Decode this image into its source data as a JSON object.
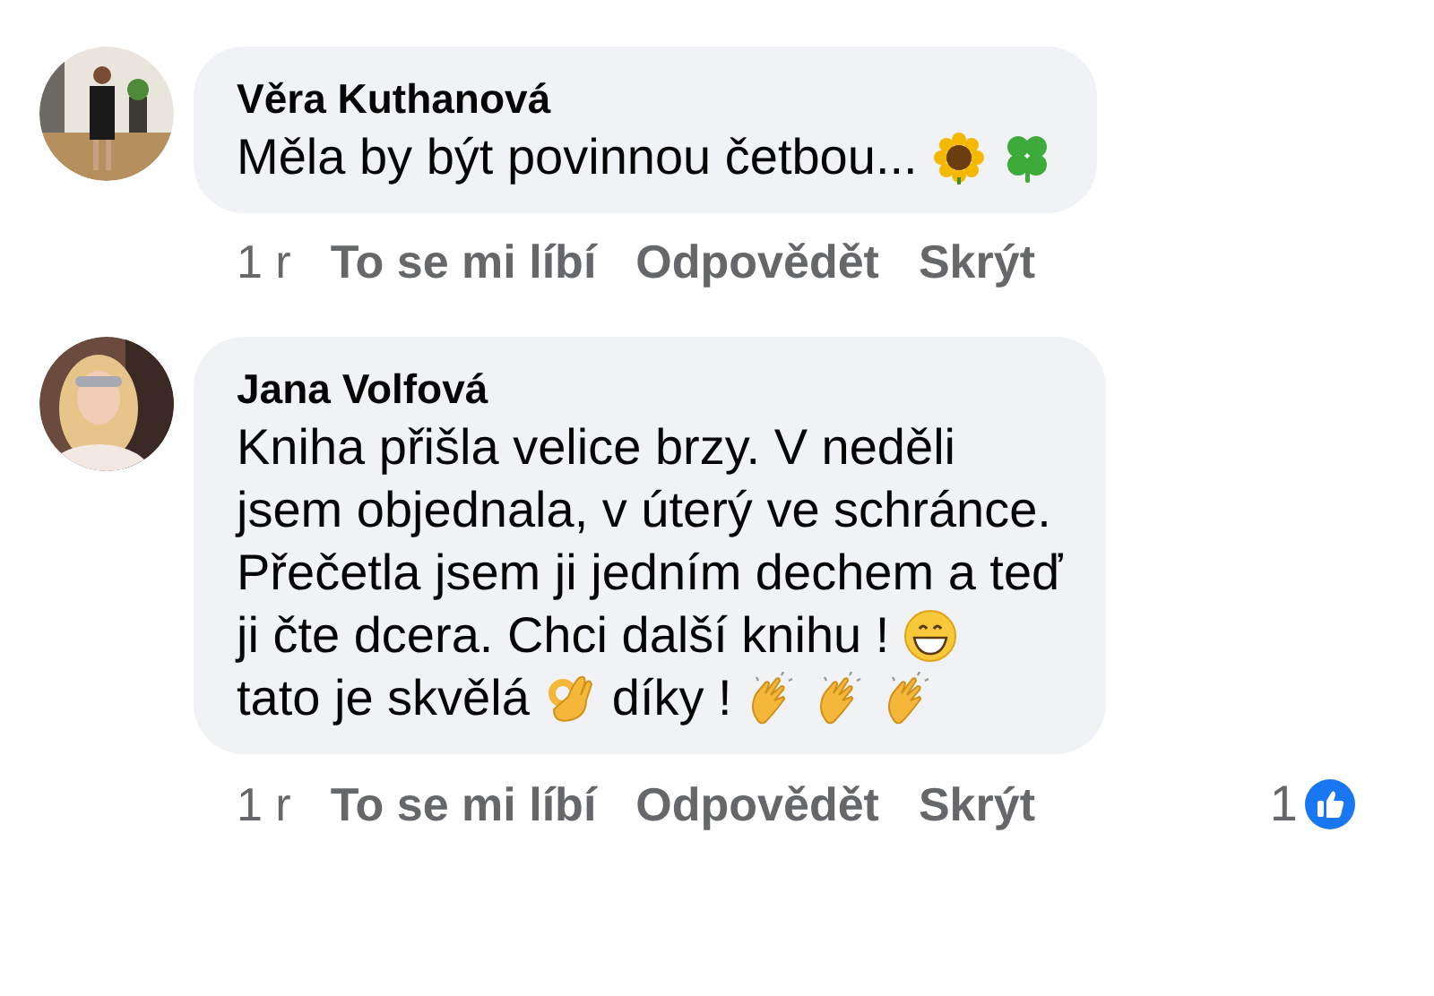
{
  "comments": [
    {
      "avatar": {
        "kind": "picture"
      },
      "author": "Věra Kuthanová",
      "lines": [
        {
          "parts": [
            {
              "kind": "text",
              "text": "Měla by být povinnou četbou..."
            },
            {
              "kind": "sunflower"
            },
            {
              "kind": "clover"
            }
          ]
        }
      ],
      "time": "1 r",
      "actions": [
        "To se mi líbí",
        "Odpovědět",
        "Skrýt"
      ]
    },
    {
      "avatar": {
        "kind": "picture"
      },
      "author": "Jana Volfová",
      "lines": [
        {
          "parts": [
            {
              "kind": "text",
              "text": "Kniha přišla velice brzy. V neděli"
            }
          ]
        },
        {
          "parts": [
            {
              "kind": "text",
              "text": "jsem objednala, v úterý ve schránce."
            }
          ]
        },
        {
          "parts": [
            {
              "kind": "text",
              "text": "Přečetla jsem ji jedním dechem a teď"
            }
          ]
        },
        {
          "parts": [
            {
              "kind": "text",
              "text": "ji čte dcera. Chci další knihu !"
            },
            {
              "kind": "grin"
            }
          ]
        },
        {
          "parts": [
            {
              "kind": "text",
              "text": "tato je skvělá"
            },
            {
              "kind": "ok-hand"
            },
            {
              "kind": "text",
              "text": "díky !"
            },
            {
              "kind": "clap"
            },
            {
              "kind": "clap"
            },
            {
              "kind": "clap"
            }
          ]
        }
      ],
      "time": "1 r",
      "actions": [
        "To se mi líbí",
        "Odpovědět",
        "Skrýt"
      ],
      "reactions": {
        "count": "1"
      }
    }
  ]
}
